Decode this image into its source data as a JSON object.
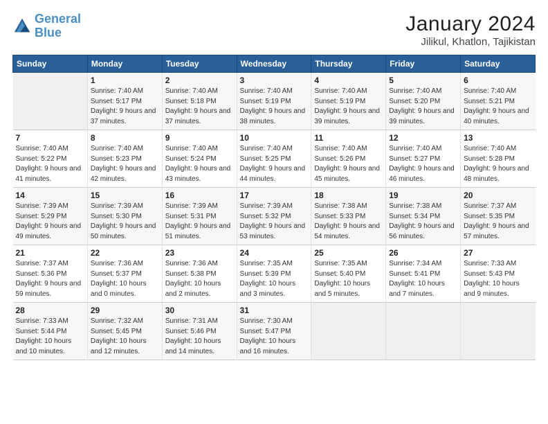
{
  "logo": {
    "line1": "General",
    "line2": "Blue"
  },
  "title": "January 2024",
  "subtitle": "Jilikul, Khatlon, Tajikistan",
  "days_of_week": [
    "Sunday",
    "Monday",
    "Tuesday",
    "Wednesday",
    "Thursday",
    "Friday",
    "Saturday"
  ],
  "weeks": [
    [
      {
        "day": "",
        "sunrise": "",
        "sunset": "",
        "daylight": ""
      },
      {
        "day": "1",
        "sunrise": "Sunrise: 7:40 AM",
        "sunset": "Sunset: 5:17 PM",
        "daylight": "Daylight: 9 hours and 37 minutes."
      },
      {
        "day": "2",
        "sunrise": "Sunrise: 7:40 AM",
        "sunset": "Sunset: 5:18 PM",
        "daylight": "Daylight: 9 hours and 37 minutes."
      },
      {
        "day": "3",
        "sunrise": "Sunrise: 7:40 AM",
        "sunset": "Sunset: 5:19 PM",
        "daylight": "Daylight: 9 hours and 38 minutes."
      },
      {
        "day": "4",
        "sunrise": "Sunrise: 7:40 AM",
        "sunset": "Sunset: 5:19 PM",
        "daylight": "Daylight: 9 hours and 39 minutes."
      },
      {
        "day": "5",
        "sunrise": "Sunrise: 7:40 AM",
        "sunset": "Sunset: 5:20 PM",
        "daylight": "Daylight: 9 hours and 39 minutes."
      },
      {
        "day": "6",
        "sunrise": "Sunrise: 7:40 AM",
        "sunset": "Sunset: 5:21 PM",
        "daylight": "Daylight: 9 hours and 40 minutes."
      }
    ],
    [
      {
        "day": "7",
        "sunrise": "Sunrise: 7:40 AM",
        "sunset": "Sunset: 5:22 PM",
        "daylight": "Daylight: 9 hours and 41 minutes."
      },
      {
        "day": "8",
        "sunrise": "Sunrise: 7:40 AM",
        "sunset": "Sunset: 5:23 PM",
        "daylight": "Daylight: 9 hours and 42 minutes."
      },
      {
        "day": "9",
        "sunrise": "Sunrise: 7:40 AM",
        "sunset": "Sunset: 5:24 PM",
        "daylight": "Daylight: 9 hours and 43 minutes."
      },
      {
        "day": "10",
        "sunrise": "Sunrise: 7:40 AM",
        "sunset": "Sunset: 5:25 PM",
        "daylight": "Daylight: 9 hours and 44 minutes."
      },
      {
        "day": "11",
        "sunrise": "Sunrise: 7:40 AM",
        "sunset": "Sunset: 5:26 PM",
        "daylight": "Daylight: 9 hours and 45 minutes."
      },
      {
        "day": "12",
        "sunrise": "Sunrise: 7:40 AM",
        "sunset": "Sunset: 5:27 PM",
        "daylight": "Daylight: 9 hours and 46 minutes."
      },
      {
        "day": "13",
        "sunrise": "Sunrise: 7:40 AM",
        "sunset": "Sunset: 5:28 PM",
        "daylight": "Daylight: 9 hours and 48 minutes."
      }
    ],
    [
      {
        "day": "14",
        "sunrise": "Sunrise: 7:39 AM",
        "sunset": "Sunset: 5:29 PM",
        "daylight": "Daylight: 9 hours and 49 minutes."
      },
      {
        "day": "15",
        "sunrise": "Sunrise: 7:39 AM",
        "sunset": "Sunset: 5:30 PM",
        "daylight": "Daylight: 9 hours and 50 minutes."
      },
      {
        "day": "16",
        "sunrise": "Sunrise: 7:39 AM",
        "sunset": "Sunset: 5:31 PM",
        "daylight": "Daylight: 9 hours and 51 minutes."
      },
      {
        "day": "17",
        "sunrise": "Sunrise: 7:39 AM",
        "sunset": "Sunset: 5:32 PM",
        "daylight": "Daylight: 9 hours and 53 minutes."
      },
      {
        "day": "18",
        "sunrise": "Sunrise: 7:38 AM",
        "sunset": "Sunset: 5:33 PM",
        "daylight": "Daylight: 9 hours and 54 minutes."
      },
      {
        "day": "19",
        "sunrise": "Sunrise: 7:38 AM",
        "sunset": "Sunset: 5:34 PM",
        "daylight": "Daylight: 9 hours and 56 minutes."
      },
      {
        "day": "20",
        "sunrise": "Sunrise: 7:37 AM",
        "sunset": "Sunset: 5:35 PM",
        "daylight": "Daylight: 9 hours and 57 minutes."
      }
    ],
    [
      {
        "day": "21",
        "sunrise": "Sunrise: 7:37 AM",
        "sunset": "Sunset: 5:36 PM",
        "daylight": "Daylight: 9 hours and 59 minutes."
      },
      {
        "day": "22",
        "sunrise": "Sunrise: 7:36 AM",
        "sunset": "Sunset: 5:37 PM",
        "daylight": "Daylight: 10 hours and 0 minutes."
      },
      {
        "day": "23",
        "sunrise": "Sunrise: 7:36 AM",
        "sunset": "Sunset: 5:38 PM",
        "daylight": "Daylight: 10 hours and 2 minutes."
      },
      {
        "day": "24",
        "sunrise": "Sunrise: 7:35 AM",
        "sunset": "Sunset: 5:39 PM",
        "daylight": "Daylight: 10 hours and 3 minutes."
      },
      {
        "day": "25",
        "sunrise": "Sunrise: 7:35 AM",
        "sunset": "Sunset: 5:40 PM",
        "daylight": "Daylight: 10 hours and 5 minutes."
      },
      {
        "day": "26",
        "sunrise": "Sunrise: 7:34 AM",
        "sunset": "Sunset: 5:41 PM",
        "daylight": "Daylight: 10 hours and 7 minutes."
      },
      {
        "day": "27",
        "sunrise": "Sunrise: 7:33 AM",
        "sunset": "Sunset: 5:43 PM",
        "daylight": "Daylight: 10 hours and 9 minutes."
      }
    ],
    [
      {
        "day": "28",
        "sunrise": "Sunrise: 7:33 AM",
        "sunset": "Sunset: 5:44 PM",
        "daylight": "Daylight: 10 hours and 10 minutes."
      },
      {
        "day": "29",
        "sunrise": "Sunrise: 7:32 AM",
        "sunset": "Sunset: 5:45 PM",
        "daylight": "Daylight: 10 hours and 12 minutes."
      },
      {
        "day": "30",
        "sunrise": "Sunrise: 7:31 AM",
        "sunset": "Sunset: 5:46 PM",
        "daylight": "Daylight: 10 hours and 14 minutes."
      },
      {
        "day": "31",
        "sunrise": "Sunrise: 7:30 AM",
        "sunset": "Sunset: 5:47 PM",
        "daylight": "Daylight: 10 hours and 16 minutes."
      },
      {
        "day": "",
        "sunrise": "",
        "sunset": "",
        "daylight": ""
      },
      {
        "day": "",
        "sunrise": "",
        "sunset": "",
        "daylight": ""
      },
      {
        "day": "",
        "sunrise": "",
        "sunset": "",
        "daylight": ""
      }
    ]
  ]
}
